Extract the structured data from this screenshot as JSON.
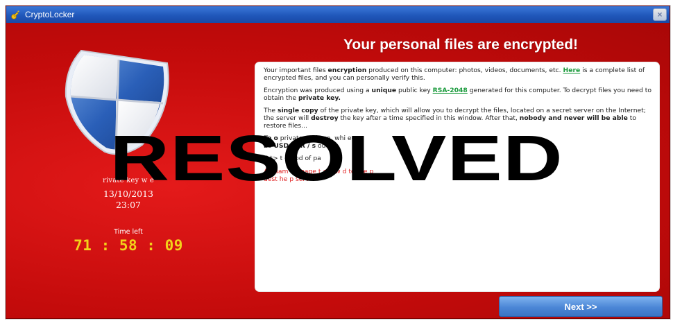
{
  "window": {
    "title": "CryptoLocker",
    "close_symbol": "×"
  },
  "heading": "Your personal files are encrypted!",
  "panel": {
    "p1_a": "Your important files ",
    "p1_b": "encryption",
    "p1_c": " produced on this computer: photos, videos, documents, etc. ",
    "p1_link": "Here",
    "p1_d": " is a complete list of encrypted files, and you can personally verify this.",
    "p2_a": "Encryption was produced using a ",
    "p2_b": "unique",
    "p2_c": " public key ",
    "p2_link": "RSA-2048",
    "p2_d": " generated for this computer. To decrypt files you need to obtain the ",
    "p2_e": "private key.",
    "p3_a": "The ",
    "p3_b": "single copy",
    "p3_c": " of the private key, which will allow you to decrypt the files, located on a secret server on the Internet; the server will ",
    "p3_d": "destroy",
    "p3_e": " the key after a time specified in this window. After that, ",
    "p3_f": "nobody and never will be able",
    "p3_g": " to restore files...",
    "p4_a": "To o",
    "p4_b": "private",
    "p4_c": "r this co",
    "p4_d": "whi",
    "p4_e": "ec",
    "p4_f": "ne",
    "p4_g": "USD",
    "p4_h": "EUR / s",
    "p4_i": "ou",
    "p4_j": "an",
    "p5_a": "C",
    "p5_b": "t>",
    "p5_c": "t",
    "p5_d": "ethod of pa",
    "p6_a": "An",
    "p6_b": "dam",
    "p6_c": "damage t",
    "p6_d": "are w",
    "p6_e": "d to the p",
    "p6_f": "dest",
    "p6_g": "he p",
    "p6_h": "serv"
  },
  "left": {
    "raised_label_a": "rivate key w",
    "raised_label_b": "e",
    "date": "13/10/2013",
    "time": "23:07",
    "time_left_label": "Time left",
    "countdown": "71 : 58 : 09"
  },
  "next_button": "Next >>",
  "stamp": "RESOLVED",
  "colors": {
    "background_red": "#c90f0f",
    "countdown_yellow": "#f2d21a",
    "link_green": "#1a9a3c",
    "button_blue": "#4b86d6"
  },
  "icons": {
    "title": "key-icon",
    "shield": "shield-icon"
  }
}
